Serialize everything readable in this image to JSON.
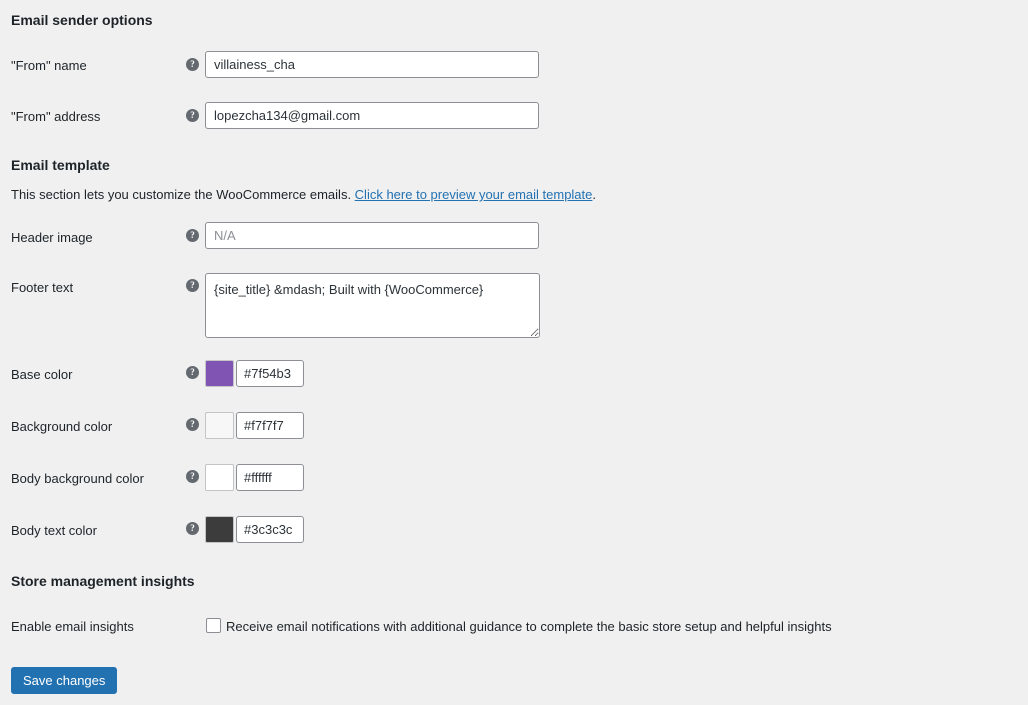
{
  "sections": {
    "sender": {
      "heading": "Email sender options",
      "rows": [
        {
          "label": "\"From\" name",
          "value": "villainess_cha",
          "placeholder": "",
          "help": "?"
        },
        {
          "label": "\"From\" address",
          "value": "lopezcha134@gmail.com",
          "placeholder": "",
          "help": "?"
        }
      ]
    },
    "template": {
      "heading": "Email template",
      "description_prefix": "This section lets you customize the WooCommerce emails. ",
      "description_link": "Click here to preview your email template",
      "description_suffix": ".",
      "header_image": {
        "label": "Header image",
        "value": "",
        "placeholder": "N/A",
        "help": "?"
      },
      "footer_text": {
        "label": "Footer text",
        "value": "{site_title} &mdash; Built with {WooCommerce}",
        "help": "?"
      },
      "colors": [
        {
          "label": "Base color",
          "hex": "#7f54b3",
          "help": "?"
        },
        {
          "label": "Background color",
          "hex": "#f7f7f7",
          "help": "?"
        },
        {
          "label": "Body background color",
          "hex": "#ffffff",
          "help": "?"
        },
        {
          "label": "Body text color",
          "hex": "#3c3c3c",
          "help": "?"
        }
      ]
    },
    "insights": {
      "heading": "Store management insights",
      "row_label": "Enable email insights",
      "checkbox_label": "Receive email notifications with additional guidance to complete the basic store setup and helpful insights",
      "checked": false
    }
  },
  "footer": {
    "save_label": "Save changes"
  },
  "theme": {
    "page_background": "#f0f0f1",
    "accent_blue": "#2271b1",
    "text_color": "#1d2327",
    "border_color": "#8c8f94",
    "placeholder_color": "#8c8f94"
  }
}
